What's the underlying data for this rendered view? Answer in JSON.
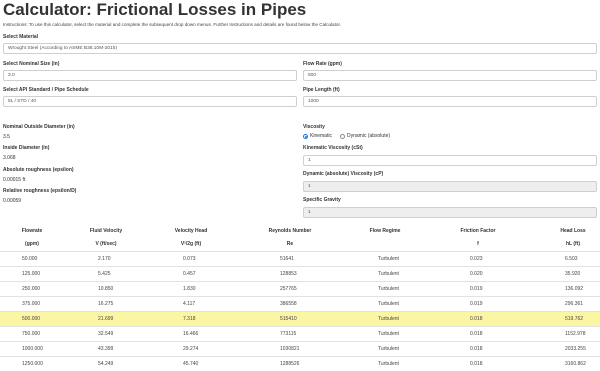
{
  "title": "Calculator: Frictional Losses in Pipes",
  "instructions": "Instructions: To use this calculator, select the material and complete the subsequent drop down menus. Further Instructions and details are found below the Calculator.",
  "material": {
    "label": "Select Material",
    "value": "Wrought Steel (According to ASME B36.10M-2015)"
  },
  "nominal_size": {
    "label": "Select Nominal Size (in)",
    "value": "3.0"
  },
  "flow_rate": {
    "label": "Flow Rate (gpm)",
    "value": "500"
  },
  "schedule": {
    "label": "Select API Standard / Pipe Schedule",
    "value": "5L / STD / 40"
  },
  "pipe_length": {
    "label": "Pipe Length (ft)",
    "value": "1000"
  },
  "outside_diameter": {
    "label": "Nominal Outside Diameter (in)",
    "value": "3.5"
  },
  "inside_diameter": {
    "label": "Inside Diameter (in)",
    "value": "3.068"
  },
  "abs_roughness": {
    "label": "Absolute roughness (epsilon)",
    "value": "0.00015 ft"
  },
  "rel_roughness": {
    "label": "Relative roughness (epsilon/D)",
    "value": "0.00059"
  },
  "viscosity": {
    "label": "Viscosity",
    "option_kinematic": "Kinematic",
    "option_dynamic": "Dynamic (absolute)"
  },
  "kinematic_viscosity": {
    "label": "Kinematic Viscosity (cSt)",
    "value": "1"
  },
  "dynamic_viscosity": {
    "label": "Dynamic (absolute) Viscosity (cP)",
    "value": "1"
  },
  "specific_gravity": {
    "label": "Specific Gravity",
    "value": "1"
  },
  "table": {
    "headers": [
      "Flowrate",
      "Fluid Velocity",
      "Velocity Head",
      "Reynolds Number",
      "Flow Regime",
      "Friction Factor",
      "Head Loss"
    ],
    "units": [
      "(gpm)",
      "V (ft/sec)",
      "V²/2g (ft)",
      "Re",
      "",
      "f",
      "hL (ft)"
    ],
    "rows": [
      [
        "50.000",
        "2.170",
        "0.073",
        "51641",
        "Turbulent",
        "0.023",
        "6.503"
      ],
      [
        "125.000",
        "5.425",
        "0.457",
        "128853",
        "Turbulent",
        "0.020",
        "35.920"
      ],
      [
        "250.000",
        "10.850",
        "1.830",
        "257765",
        "Turbulent",
        "0.019",
        "136.092"
      ],
      [
        "375.000",
        "16.275",
        "4.117",
        "386558",
        "Turbulent",
        "0.019",
        "296.361"
      ],
      [
        "500.000",
        "21.699",
        "7.318",
        "515410",
        "Turbulent",
        "0.018",
        "519.762"
      ],
      [
        "750.000",
        "32.549",
        "16.466",
        "773115",
        "Turbulent",
        "0.018",
        "1152.978"
      ],
      [
        "1000.000",
        "43.399",
        "29.274",
        "1030821",
        "Turbulent",
        "0.018",
        "2033.255"
      ],
      [
        "1250.000",
        "54.249",
        "45.740",
        "1288526",
        "Turbulent",
        "0.018",
        "3160.862"
      ]
    ],
    "highlight_row": 4,
    "highlight_color": "#fbf6a3"
  }
}
